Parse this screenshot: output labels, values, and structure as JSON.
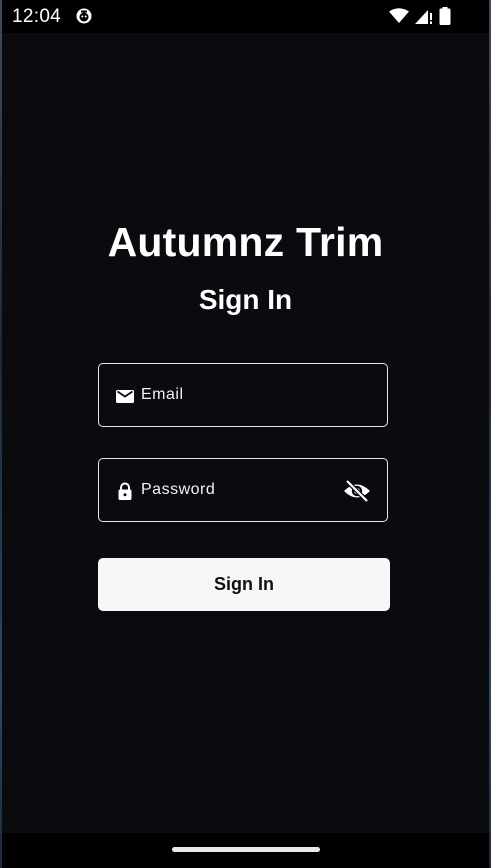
{
  "status_bar": {
    "time": "12:04",
    "icons": [
      "app-notification-icon",
      "wifi-icon",
      "cell-signal-icon",
      "battery-icon"
    ]
  },
  "app": {
    "title": "Autumnz Trim",
    "page_title": "Sign In"
  },
  "form": {
    "email": {
      "placeholder": "Email",
      "value": "",
      "icon": "mail-icon"
    },
    "password": {
      "placeholder": "Password",
      "value": "",
      "icon": "lock-icon",
      "toggle_icon": "eye-off-icon"
    },
    "submit_label": "Sign In"
  },
  "colors": {
    "background": "#0b0b0f",
    "text": "#ffffff",
    "field_border": "#e8e8ee",
    "button_bg": "#f7f6f8",
    "button_text": "#111111"
  }
}
